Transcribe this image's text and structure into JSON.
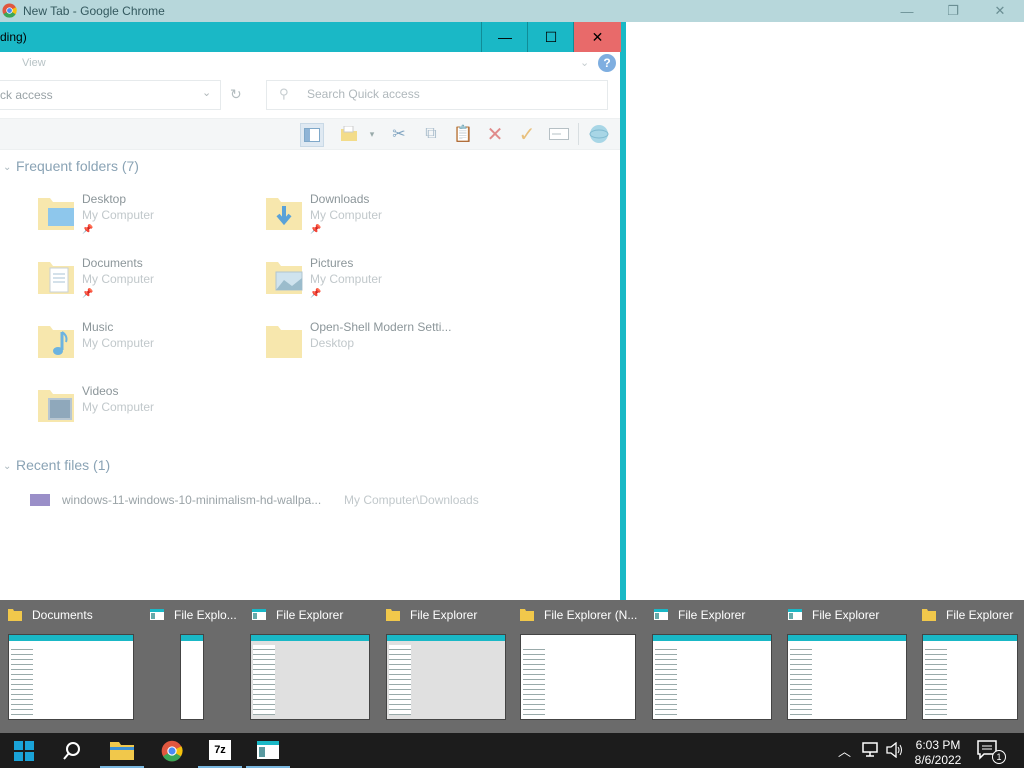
{
  "chrome": {
    "title": "New Tab - Google Chrome",
    "minimize": "—",
    "maximize": "❐",
    "close": "✕"
  },
  "explorer": {
    "title": "ding)",
    "minimize": "—",
    "maximize": "☐",
    "close": "✕",
    "ribbon_tab_view": "View",
    "help": "?",
    "address": "ck access",
    "search_placeholder": "Search Quick access",
    "frequent_header": "Frequent folders (7)",
    "recent_header": "Recent files (1)",
    "folders": [
      {
        "name": "Desktop",
        "location": "My Computer"
      },
      {
        "name": "Downloads",
        "location": "My Computer"
      },
      {
        "name": "Documents",
        "location": "My Computer"
      },
      {
        "name": "Pictures",
        "location": "My Computer"
      },
      {
        "name": "Music",
        "location": "My Computer"
      },
      {
        "name": "Open-Shell Modern Setti...",
        "location": "Desktop"
      },
      {
        "name": "Videos",
        "location": "My Computer"
      }
    ],
    "recent_file": {
      "name": "windows-11-windows-10-minimalism-hd-wallpa...",
      "path": "My Computer\\Downloads"
    }
  },
  "thumbnails": [
    {
      "title": "Documents"
    },
    {
      "title": "File Explo..."
    },
    {
      "title": "File Explorer"
    },
    {
      "title": "File Explorer"
    },
    {
      "title": "File Explorer (N..."
    },
    {
      "title": "File Explorer"
    },
    {
      "title": "File Explorer"
    },
    {
      "title": "File Explorer"
    }
  ],
  "taskbar": {
    "time": "6:03 PM",
    "date": "8/6/2022",
    "notification_count": "1",
    "app_7zip": "7z"
  },
  "colors": {
    "accent": "#1ab8c6",
    "close_red": "#e86a6a",
    "taskbar": "#1c1c1c"
  }
}
